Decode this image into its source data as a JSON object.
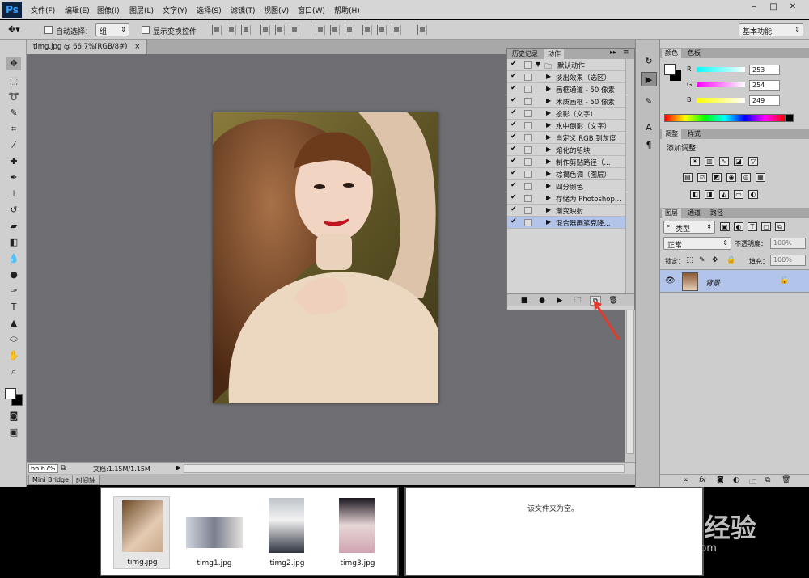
{
  "app": {
    "logo": "Ps"
  },
  "menu": [
    "文件(F)",
    "编辑(E)",
    "图像(I)",
    "图层(L)",
    "文字(Y)",
    "选择(S)",
    "滤镜(T)",
    "视图(V)",
    "窗口(W)",
    "帮助(H)"
  ],
  "window_controls": {
    "minimize": "–",
    "restore": "□",
    "close": "✕"
  },
  "options": {
    "auto_select_label": "自动选择：",
    "auto_select_value": "组",
    "show_transform_label": "显示变换控件",
    "workspace": "基本功能"
  },
  "document": {
    "tab_title": "timg.jpg @ 66.7%(RGB/8#)",
    "tab_close": "×",
    "zoom": "66.67%",
    "doc_size": "文档:1.15M/1.15M"
  },
  "bottom_tabs": [
    "Mini Bridge",
    "时间轴"
  ],
  "actions_panel": {
    "tabs": [
      "历史记录",
      "动作"
    ],
    "group": "默认动作",
    "items": [
      "淡出效果（选区）",
      "画框通道 - 50 像素",
      "木质画框 - 50 像素",
      "投影（文字）",
      "水中倒影（文字）",
      "自定义 RGB 到灰度",
      "熔化的铅块",
      "制作剪贴路径（...",
      "棕褐色调（图层）",
      "四分颜色",
      "存储为 Photoshop...",
      "渐变映射",
      "混合器画笔克隆..."
    ]
  },
  "color_panel": {
    "tabs": [
      "颜色",
      "色板"
    ],
    "channels": [
      {
        "label": "R",
        "value": "253"
      },
      {
        "label": "G",
        "value": "254"
      },
      {
        "label": "B",
        "value": "249"
      }
    ]
  },
  "adjust_panel": {
    "tabs": [
      "调整",
      "样式"
    ],
    "title": "添加调整"
  },
  "layers_panel": {
    "tabs": [
      "图层",
      "通道",
      "路径"
    ],
    "kind": "类型",
    "blend": "正常",
    "opacity_label": "不透明度：",
    "opacity": "100%",
    "lock_label": "锁定：",
    "fill_label": "填充：",
    "fill": "100%",
    "layer_name": "背景",
    "footer_icons": [
      "link-icon",
      "fx-icon",
      "mask-icon",
      "adjust-icon",
      "folder-icon",
      "new-layer-icon",
      "trash-icon"
    ]
  },
  "filmstrip": {
    "thumbnails": [
      "timg.jpg",
      "timg1.jpg",
      "timg2.jpg",
      "timg3.jpg"
    ],
    "empty_message": "该文件夹为空。"
  },
  "watermark": {
    "brand": "Baidu经验",
    "url": "jingyan.baidu.com"
  },
  "colors": {
    "canvas_bg": "#6f6e72",
    "selection": "#b3c4ea",
    "arrow": "#e03b2d"
  }
}
